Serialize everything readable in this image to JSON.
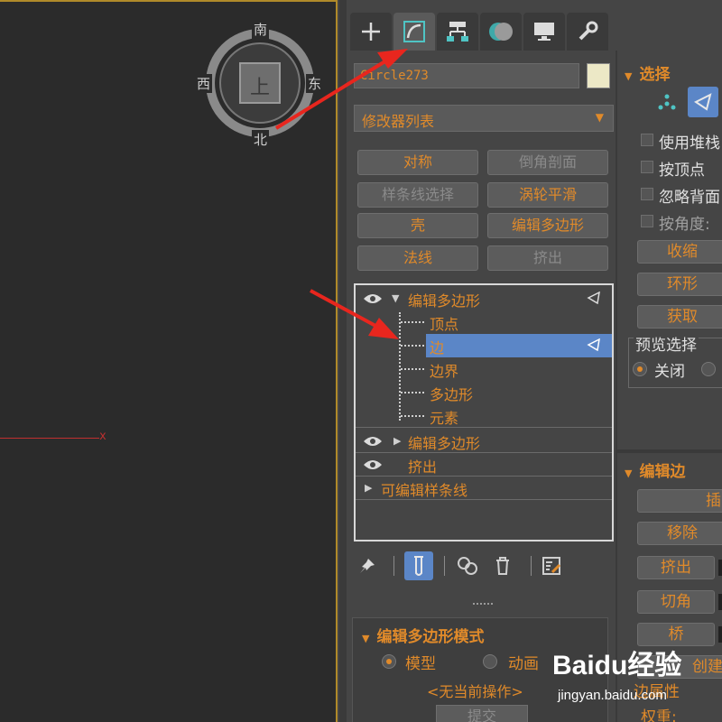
{
  "viewport": {
    "axis_label": "x",
    "compass": {
      "south": "南",
      "north": "北",
      "west": "西",
      "east": "东",
      "cube": "上"
    }
  },
  "tabs": [
    "create-icon",
    "modify-icon",
    "hierarchy-icon",
    "motion-icon",
    "display-icon",
    "utilities-icon"
  ],
  "object": {
    "name": "Circle273",
    "color": "#ece8c6"
  },
  "modifier_list": {
    "label": "修改器列表"
  },
  "modifier_buttons": [
    {
      "label": "对称",
      "enabled": true
    },
    {
      "label": "倒角剖面",
      "enabled": false
    },
    {
      "label": "样条线选择",
      "enabled": false
    },
    {
      "label": "涡轮平滑",
      "enabled": true
    },
    {
      "label": "壳",
      "enabled": true
    },
    {
      "label": "编辑多边形",
      "enabled": true
    },
    {
      "label": "法线",
      "enabled": true
    },
    {
      "label": "挤出",
      "enabled": false
    }
  ],
  "stack": {
    "top": {
      "label": "编辑多边形",
      "expanded": true
    },
    "sub": [
      "顶点",
      "边",
      "边界",
      "多边形",
      "元素"
    ],
    "selected_sub": "边",
    "rows": [
      {
        "label": "编辑多边形",
        "eye": true,
        "arrow": "right"
      },
      {
        "label": "挤出",
        "eye": true,
        "arrow": ""
      },
      {
        "label": "可编辑样条线",
        "eye": false,
        "arrow": "right"
      }
    ]
  },
  "mode_rollout": {
    "title": "编辑多边形模式",
    "model": "模型",
    "animate": "动画",
    "status": "<无当前操作>",
    "submit": "提交"
  },
  "selection_rollout": {
    "title": "选择",
    "checks": [
      "使用堆栈",
      "按顶点",
      "忽略背面",
      "按角度:"
    ],
    "buttons": [
      "收缩",
      "环形",
      "获取"
    ],
    "preview_title": "预览选择",
    "preview_off": "关闭"
  },
  "edit_edges_rollout": {
    "title": "编辑边",
    "buttons": [
      "插",
      "移除",
      "挤出",
      "切角",
      "桥",
      "创建"
    ],
    "partial_text": "边属性",
    "weight_text": "权重:"
  },
  "watermark": {
    "logo": "Baidu经验",
    "url": "jingyan.baidu.com"
  },
  "colors": {
    "accent": "#e08a2a",
    "selection": "#5b86c7",
    "panel": "#454545",
    "viewport": "#2b2b2b"
  }
}
